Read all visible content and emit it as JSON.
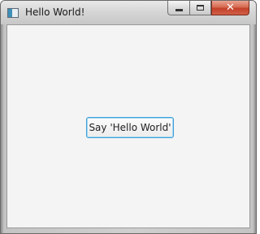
{
  "window": {
    "title": "Hello World!",
    "icon": "java-app-icon",
    "caption_buttons": {
      "minimize": "minimize-icon",
      "maximize": "maximize-icon",
      "close": "close-icon",
      "close_glyph": "✕"
    }
  },
  "main": {
    "button_label": "Say 'Hello World'"
  },
  "colors": {
    "client_background": "#f4f4f4",
    "button_focus_border": "#3d9fd8",
    "close_button": "#c4412a"
  }
}
